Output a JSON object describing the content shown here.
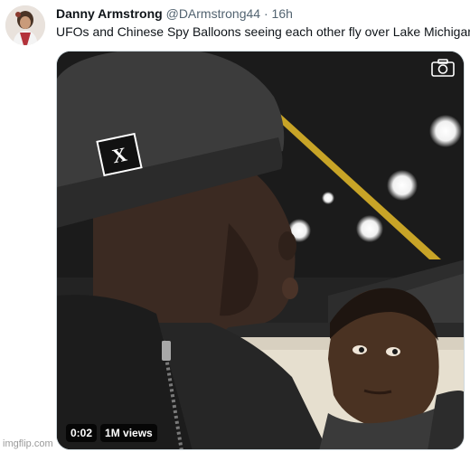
{
  "tweet": {
    "display_name": "Danny Armstrong",
    "handle": "@DArmstrong44",
    "separator": "·",
    "time": "16h",
    "text": "UFOs and Chinese Spy Balloons seeing each other fly over Lake Michigan:"
  },
  "media": {
    "duration": "0:02",
    "views": "1M views",
    "camera_icon": "camera-icon",
    "hat_logo": "X"
  },
  "watermark": "imgflip.com",
  "colors": {
    "text": "#0f1419",
    "secondary": "#536471",
    "ceiling_rail": "#c8a427"
  }
}
